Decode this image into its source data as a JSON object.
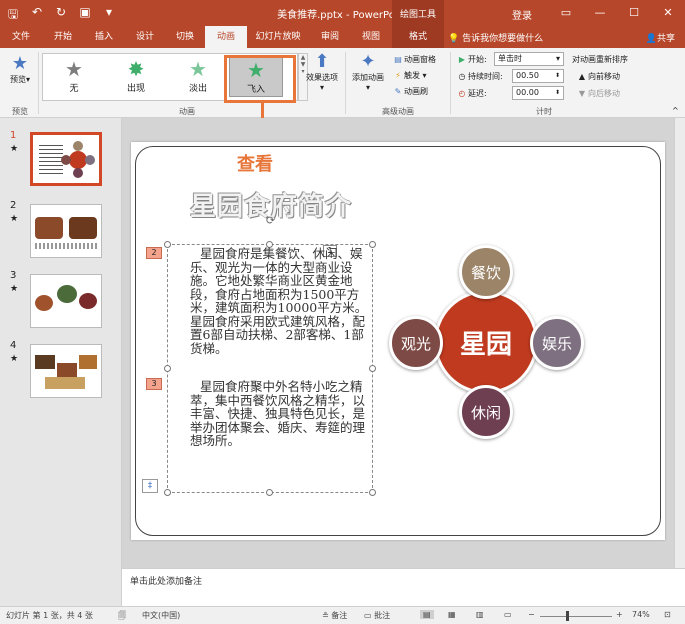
{
  "titlebar": {
    "doc_title": "美食推荐.pptx - PowerPoint",
    "context_tools": "绘图工具",
    "login": "登录"
  },
  "tabs": [
    "文件",
    "开始",
    "插入",
    "设计",
    "切换",
    "动画",
    "幻灯片放映",
    "审阅",
    "视图",
    "格式"
  ],
  "active_tab": "动画",
  "tell_me": "告诉我你想要做什么",
  "share": "共享",
  "ribbon": {
    "preview_label": "预览",
    "preview_group": "预览",
    "animation_group": "动画",
    "advanced_group": "高级动画",
    "timing_group": "计时",
    "gallery": [
      {
        "label": "无"
      },
      {
        "label": "出现"
      },
      {
        "label": "淡出"
      },
      {
        "label": "飞入"
      }
    ],
    "selected_effect": "飞入",
    "effect_options": "效果选项",
    "add_animation": "添加动画",
    "animation_pane": "动画窗格",
    "trigger": "触发",
    "animation_painter": "动画刷",
    "start_label": "开始:",
    "start_value": "单击时",
    "duration_label": "持续时间:",
    "duration_value": "00.50",
    "delay_label": "延迟:",
    "delay_value": "00.00",
    "reorder_title": "对动画重新排序",
    "move_earlier": "向前移动",
    "move_later": "向后移动"
  },
  "slides": [
    {
      "num": "1",
      "star": "★"
    },
    {
      "num": "2",
      "star": "★"
    },
    {
      "num": "3",
      "star": "★"
    },
    {
      "num": "4",
      "star": "★"
    }
  ],
  "annotation": "查看",
  "slide": {
    "title": "星园食府简介",
    "tag_1": "1",
    "tag_2": "2",
    "tag_3": "3",
    "para1": "星园食府是集餐饮、休闲、娱乐、观光为一体的大型商业设施。它地处繁华商业区黄金地段，食府占地面积为1500平方米，建筑面积为10000平方米。星园食府采用欧式建筑风格，配置6部自动扶梯、2部客梯、1部货梯。",
    "para2": "星园食府聚中外名特小吃之精萃，集中西餐饮风格之精华，以丰富、快捷、独具特色见长，是举办团体聚会、婚庆、寿筵的理想场所。",
    "diagram": {
      "center": "星园",
      "top": "餐饮",
      "left": "观光",
      "right": "娱乐",
      "bottom": "休闲"
    }
  },
  "notes_placeholder": "单击此处添加备注",
  "status": {
    "slide_info": "幻灯片 第 1 张，共 4 张",
    "language": "中文(中国)",
    "notes": "备注",
    "comments": "批注",
    "zoom": "74%"
  }
}
